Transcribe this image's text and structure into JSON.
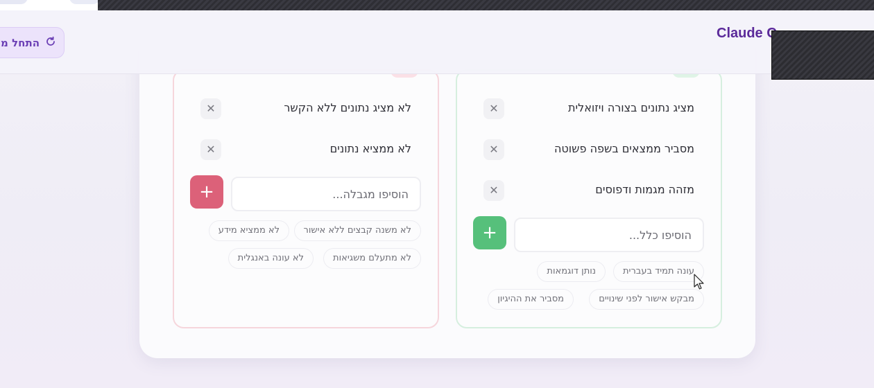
{
  "header": {
    "brand": "Claude C",
    "restart_label": "התחל מ"
  },
  "do_column": {
    "items": [
      {
        "label": "מציג נתונים בצורה ויזואלית"
      },
      {
        "label": "מסביר ממצאים בשפה פשוטה"
      },
      {
        "label": "מזהה מגמות ודפוסים"
      }
    ],
    "add_placeholder": "הוסיפו כלל...",
    "suggestions": [
      "עונה תמיד בעברית",
      "נותן דוגמאות",
      "מבקש אישור לפני שינויים",
      "מסביר את ההיגיון"
    ]
  },
  "dont_column": {
    "items": [
      {
        "label": "לא מציג נתונים ללא הקשר"
      },
      {
        "label": "לא ממציא נתונים"
      }
    ],
    "add_placeholder": "הוסיפו מגבלה...",
    "suggestions": [
      "לא משנה קבצים ללא אישור",
      "לא ממציא מידע",
      "לא מתעלם משגיאות",
      "לא עונה באנגלית"
    ]
  },
  "icons": {
    "remove": "close-icon",
    "add": "plus-icon",
    "restart": "refresh-icon"
  },
  "colors": {
    "accent": "#5b2a9a",
    "do_accent": "#56c07b",
    "dont_accent": "#dc6179"
  }
}
